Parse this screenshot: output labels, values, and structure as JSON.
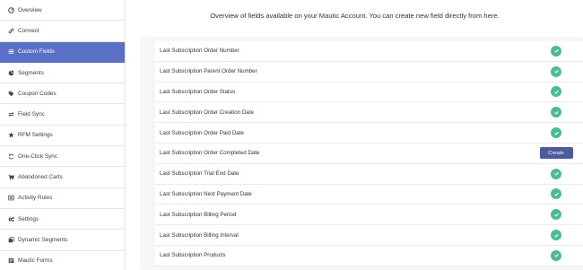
{
  "sidebar": {
    "items": [
      {
        "label": "Overview",
        "icon": "overview-icon"
      },
      {
        "label": "Connect",
        "icon": "link-icon"
      },
      {
        "label": "Custom Fields",
        "icon": "list-icon",
        "active": true
      },
      {
        "label": "Segments",
        "icon": "pie-chart-icon"
      },
      {
        "label": "Coupon Codes",
        "icon": "tag-icon"
      },
      {
        "label": "Field Sync",
        "icon": "sync-arrows-icon"
      },
      {
        "label": "RFM Settings",
        "icon": "star-icon"
      },
      {
        "label": "One-Click Sync",
        "icon": "sync-icon"
      },
      {
        "label": "Abandoned Carts",
        "icon": "cart-icon"
      },
      {
        "label": "Activity Rules",
        "icon": "rules-list-icon"
      },
      {
        "label": "Settings",
        "icon": "gears-icon"
      },
      {
        "label": "Dynamic Segments",
        "icon": "copy-icon"
      },
      {
        "label": "Mautic Forms",
        "icon": "form-icon"
      }
    ]
  },
  "main": {
    "intro": "Overview of fields available on your Mautic Account. You can create new field directly from here.",
    "create_label": "Create",
    "fields": [
      {
        "label": "Last Subscription Order Number",
        "status": "check-icon"
      },
      {
        "label": "Last Subscription Parent Order Number",
        "status": "check-icon"
      },
      {
        "label": "Last Subscription Order Status",
        "status": "check-icon"
      },
      {
        "label": "Last Subscription Order Creation Date",
        "status": "check-icon"
      },
      {
        "label": "Last Subscription Order Paid Date",
        "status": "check-icon"
      },
      {
        "label": "Last Subscription Order Completed Date",
        "status": "create-button"
      },
      {
        "label": "Last Subscription Trial End Date",
        "status": "check-icon"
      },
      {
        "label": "Last Subscription Next Payment Date",
        "status": "check-icon"
      },
      {
        "label": "Last Subscription Billing Period",
        "status": "check-icon"
      },
      {
        "label": "Last Subscription Billing Interval",
        "status": "check-icon"
      },
      {
        "label": "Last Subscription Products",
        "status": "check-icon"
      }
    ]
  },
  "colors": {
    "accent": "#5a6fc6",
    "button": "#4e5a9e",
    "check": "#4cbb95"
  }
}
